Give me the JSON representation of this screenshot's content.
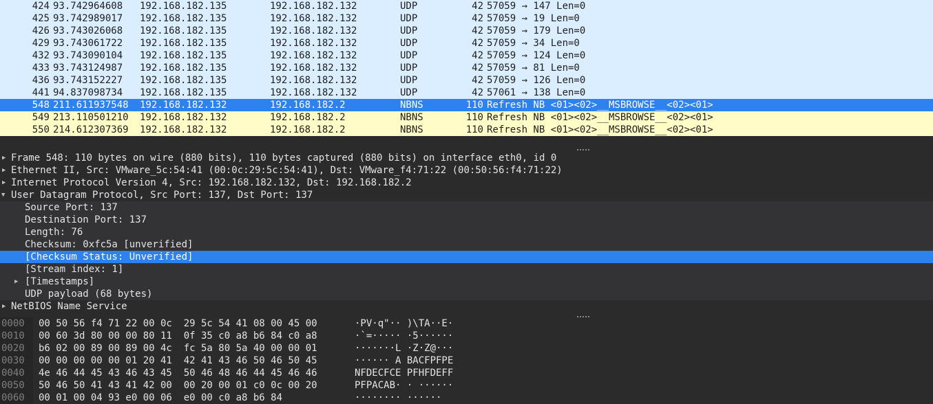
{
  "packets": [
    {
      "no": "424",
      "time": "93.742964608",
      "src": "192.168.182.135",
      "dst": "192.168.182.132",
      "proto": "UDP",
      "len": "42",
      "info": "57059 → 147 Len=0"
    },
    {
      "no": "425",
      "time": "93.742989017",
      "src": "192.168.182.135",
      "dst": "192.168.182.132",
      "proto": "UDP",
      "len": "42",
      "info": "57059 → 19 Len=0"
    },
    {
      "no": "426",
      "time": "93.743026068",
      "src": "192.168.182.135",
      "dst": "192.168.182.132",
      "proto": "UDP",
      "len": "42",
      "info": "57059 → 179 Len=0"
    },
    {
      "no": "429",
      "time": "93.743061722",
      "src": "192.168.182.135",
      "dst": "192.168.182.132",
      "proto": "UDP",
      "len": "42",
      "info": "57059 → 34 Len=0"
    },
    {
      "no": "432",
      "time": "93.743090104",
      "src": "192.168.182.135",
      "dst": "192.168.182.132",
      "proto": "UDP",
      "len": "42",
      "info": "57059 → 124 Len=0"
    },
    {
      "no": "433",
      "time": "93.743124987",
      "src": "192.168.182.135",
      "dst": "192.168.182.132",
      "proto": "UDP",
      "len": "42",
      "info": "57059 → 81 Len=0"
    },
    {
      "no": "436",
      "time": "93.743152227",
      "src": "192.168.182.135",
      "dst": "192.168.182.132",
      "proto": "UDP",
      "len": "42",
      "info": "57059 → 126 Len=0"
    },
    {
      "no": "441",
      "time": "94.837098734",
      "src": "192.168.182.135",
      "dst": "192.168.182.132",
      "proto": "UDP",
      "len": "42",
      "info": "57061 → 138 Len=0"
    },
    {
      "no": "548",
      "time": "211.611937548",
      "src": "192.168.182.132",
      "dst": "192.168.182.2",
      "proto": "NBNS",
      "len": "110",
      "info": "Refresh NB <01><02>__MSBROWSE__<02><01>"
    },
    {
      "no": "549",
      "time": "213.110501210",
      "src": "192.168.182.132",
      "dst": "192.168.182.2",
      "proto": "NBNS",
      "len": "110",
      "info": "Refresh NB <01><02>__MSBROWSE__<02><01>"
    },
    {
      "no": "550",
      "time": "214.612307369",
      "src": "192.168.182.132",
      "dst": "192.168.182.2",
      "proto": "NBNS",
      "len": "110",
      "info": "Refresh NB <01><02>__MSBROWSE__<02><01>"
    }
  ],
  "details": {
    "frame": "Frame 548: 110 bytes on wire (880 bits), 110 bytes captured (880 bits) on interface eth0, id 0",
    "ethernet": "Ethernet II, Src: VMware_5c:54:41 (00:0c:29:5c:54:41), Dst: VMware_f4:71:22 (00:50:56:f4:71:22)",
    "ip": "Internet Protocol Version 4, Src: 192.168.182.132, Dst: 192.168.182.2",
    "udp": "User Datagram Protocol, Src Port: 137, Dst Port: 137",
    "udp_fields": {
      "src_port": "Source Port: 137",
      "dst_port": "Destination Port: 137",
      "length": "Length: 76",
      "checksum": "Checksum: 0xfc5a [unverified]",
      "checksum_status": "[Checksum Status: Unverified]",
      "stream_index": "[Stream index: 1]",
      "timestamps": "[Timestamps]",
      "payload": "UDP payload (68 bytes)"
    },
    "nbns": "NetBIOS Name Service"
  },
  "bytes": [
    {
      "offset": "0000",
      "hex": "00 50 56 f4 71 22 00 0c  29 5c 54 41 08 00 45 00",
      "ascii": "·PV·q\"·· )\\TA··E·"
    },
    {
      "offset": "0010",
      "hex": "00 60 3d 80 00 00 80 11  0f 35 c0 a8 b6 84 c0 a8",
      "ascii": "·`=····· ·5······"
    },
    {
      "offset": "0020",
      "hex": "b6 02 00 89 00 89 00 4c  fc 5a 80 5a 40 00 00 01",
      "ascii": "·······L ·Z·Z@···"
    },
    {
      "offset": "0030",
      "hex": "00 00 00 00 00 01 20 41  42 41 43 46 50 46 50 45",
      "ascii": "······ A BACFPFPE"
    },
    {
      "offset": "0040",
      "hex": "4e 46 44 45 43 46 43 45  50 46 48 46 44 45 46 46",
      "ascii": "NFDECFCE PFHFDEFF"
    },
    {
      "offset": "0050",
      "hex": "50 46 50 41 43 41 42 00  00 20 00 01 c0 0c 00 20",
      "ascii": "PFPACAB· · ······"
    },
    {
      "offset": "0060",
      "hex": "00 01 00 04 93 e0 00 06  e0 00 c0 a8 b6 84",
      "ascii": "········ ······"
    }
  ],
  "colors": {
    "udp_row": "#daeeff",
    "nbns_row": "#fffcc8",
    "selection": "#2e82f0"
  }
}
